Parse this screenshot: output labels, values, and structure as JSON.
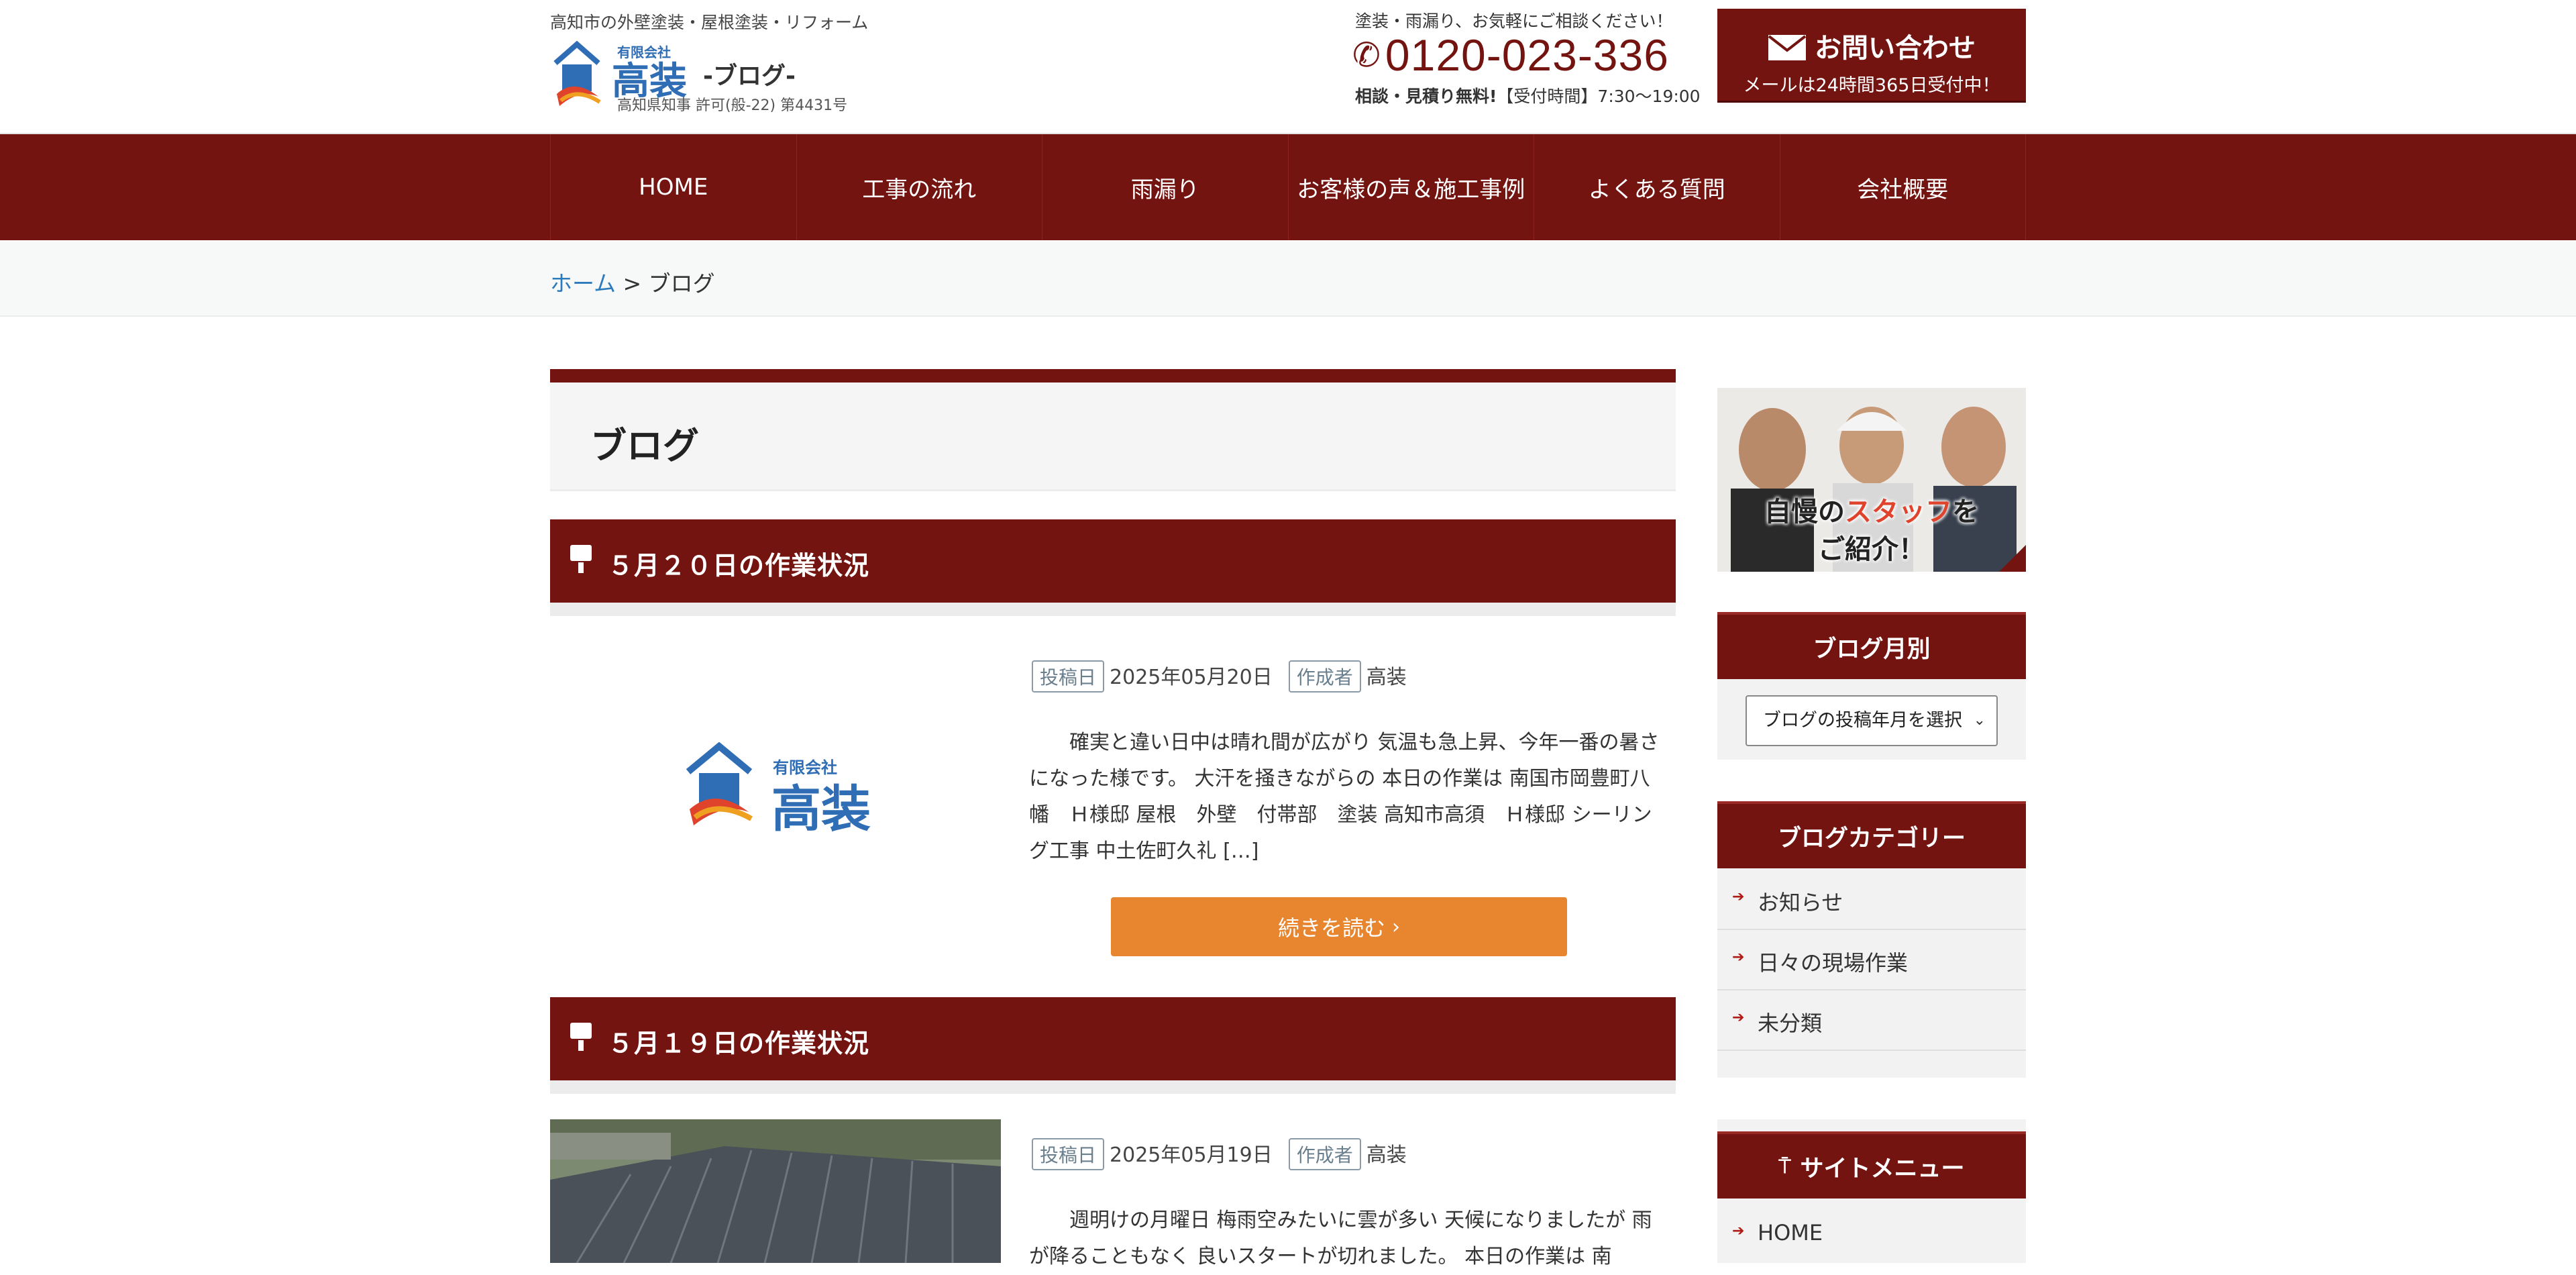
{
  "header": {
    "tagline": "高知市の外壁塗装・屋根塗装・リフォーム",
    "logo_small": "有限会社",
    "logo_name": "高装",
    "blog_word": "-ブログ-",
    "license": "高知県知事 許可(般-22) 第4431号",
    "tel_lead": "塗装・雨漏り、お気軽にご相談ください！",
    "tel": "0120-023-336",
    "tel_note_bold": "相談・見積り無料!",
    "tel_note": "【受付時間】7:30〜19:00",
    "contact_title": "お問い合わせ",
    "contact_sub": "メールは24時間365日受付中！"
  },
  "nav": {
    "items": [
      "HOME",
      "工事の流れ",
      "雨漏り",
      "お客様の声＆施工事例",
      "よくある質問",
      "会社概要"
    ]
  },
  "breadcrumb": {
    "home": "ホーム",
    "sep": " > ",
    "current": "ブログ"
  },
  "page": {
    "title": "ブログ"
  },
  "posts": [
    {
      "title": "５月２０日の作業状況",
      "date_label": "投稿日",
      "date": "2025年05月20日",
      "author_label": "作成者",
      "author": "高装",
      "excerpt": "　　確実と違い日中は晴れ間が広がり 気温も急上昇、今年一番の暑さになった様です。 大汗を掻きながらの 本日の作業は 南国市岡豊町八幡　Ｈ様邸 屋根　外壁　付帯部　塗装 高知市高須　Ｈ様邸 シーリング工事 中土佐町久礼 […]",
      "more": "続きを読む"
    },
    {
      "title": "５月１９日の作業状況",
      "date_label": "投稿日",
      "date": "2025年05月19日",
      "author_label": "作成者",
      "author": "高装",
      "excerpt": "　　週明けの月曜日 梅雨空みたいに雲が多い 天候になりましたが 雨が降ることもなく 良いスタートが切れました。 本日の作業は 南"
    }
  ],
  "thumb_logo": {
    "small": "有限会社",
    "name": "高装"
  },
  "sidebar": {
    "staff_banner": {
      "line1_a": "自慢の",
      "line1_b": "スタッフ",
      "line1_c": "を",
      "line2": "ご紹介！"
    },
    "archive_title": "ブログ月別",
    "archive_select": "ブログの投稿年月を選択",
    "category_title": "ブログカテゴリー",
    "categories": [
      "お知らせ",
      "日々の現場作業",
      "未分類"
    ],
    "sitemenu_title": "サイトメニュー",
    "sitemenu": [
      "HOME"
    ]
  },
  "colors": {
    "brand": "#731411",
    "accent": "#e8852f",
    "link": "#2c7bbd"
  }
}
